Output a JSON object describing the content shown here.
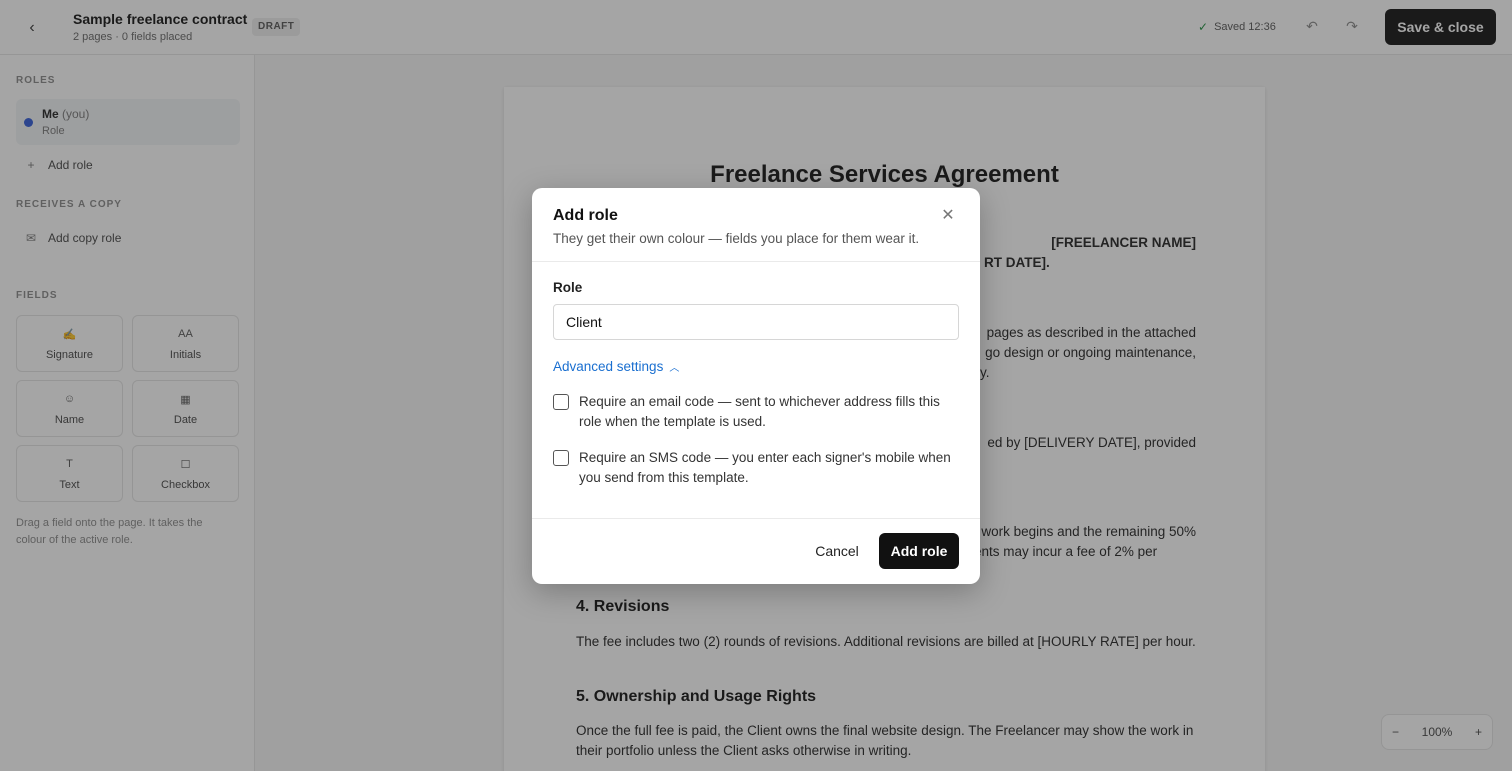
{
  "header": {
    "back_icon": "‹",
    "title": "Sample freelance contract",
    "subtitle": "2 pages · 0 fields placed",
    "badge": "DRAFT",
    "saved": "Saved 12:36",
    "save_close": "Save & close"
  },
  "sidebar": {
    "roles_label": "ROLES",
    "role": {
      "name": "Me",
      "you": "(you)",
      "type": "Role",
      "color": "#2f5bd8"
    },
    "add_role": "Add role",
    "copy_label": "RECEIVES A COPY",
    "add_copy_role": "Add copy role",
    "fields_label": "FIELDS",
    "fields": [
      {
        "label": "Signature",
        "icon": "signature-icon"
      },
      {
        "label": "Initials",
        "icon": "initials-icon"
      },
      {
        "label": "Name",
        "icon": "person-icon"
      },
      {
        "label": "Date",
        "icon": "calendar-icon"
      },
      {
        "label": "Text",
        "icon": "text-icon"
      },
      {
        "label": "Checkbox",
        "icon": "checkbox-icon"
      }
    ],
    "hint": "Drag a field onto the page. It takes the colour of the active role."
  },
  "document": {
    "title": "Freelance Services Agreement",
    "para1_right": "[FREELANCER NAME]",
    "para1_right2": "RT DATE].",
    "para2_a": "pages as described in the attached",
    "para2_b": "go design or ongoing maintenance,",
    "para2_c": "y.",
    "para3": "ed by [DELIVERY DATE], provided",
    "para4_a": "work begins and the remaining 50%",
    "para4_b": "ents may incur a fee of 2% per",
    "h4": "4. Revisions",
    "p4": "The fee includes two (2) rounds of revisions. Additional revisions are billed at [HOURLY RATE] per hour.",
    "h5": "5. Ownership and Usage Rights",
    "p5": "Once the full fee is paid, the Client owns the final website design. The Freelancer may show the work in their portfolio unless the Client asks otherwise in writing."
  },
  "zoom": {
    "value": "100%",
    "minus": "−",
    "plus": "+"
  },
  "modal": {
    "title": "Add role",
    "subtitle": "They get their own colour — fields you place for them wear it.",
    "role_label": "Role",
    "role_value": "Client",
    "advanced": "Advanced settings",
    "check1": "Require an email code — sent to whichever address fills this role when the template is used.",
    "check2": "Require an SMS code — you enter each signer's mobile when you send from this template.",
    "cancel": "Cancel",
    "submit": "Add role"
  }
}
